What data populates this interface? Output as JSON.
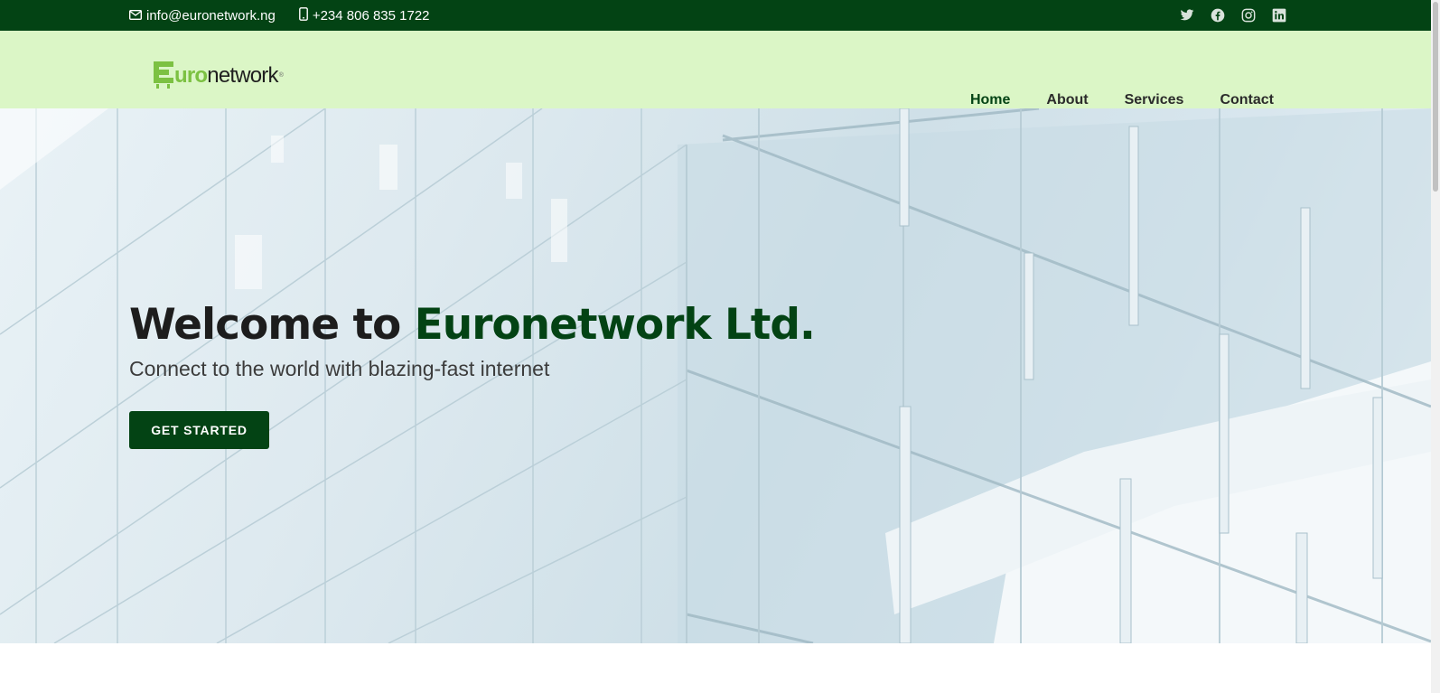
{
  "topbar": {
    "email": "info@euronetwork.ng",
    "phone": "+234 806 835 1722",
    "social": [
      "twitter-icon",
      "facebook-icon",
      "instagram-icon",
      "linkedin-icon"
    ]
  },
  "header": {
    "logo": {
      "part_uro": "uro",
      "part_network": "network",
      "mark": "®"
    },
    "nav": [
      {
        "label": "Home",
        "active": true
      },
      {
        "label": "About",
        "active": false
      },
      {
        "label": "Services",
        "active": false
      },
      {
        "label": "Contact",
        "active": false
      }
    ]
  },
  "hero": {
    "title_prefix": "Welcome to ",
    "title_brand": "Euronetwork Ltd.",
    "subtitle": "Connect to the world with blazing-fast internet",
    "cta_label": "GET STARTED"
  },
  "colors": {
    "topbar_bg": "#034314",
    "header_bg": "#dbf6c6",
    "brand_dark_green": "#034314",
    "logo_green": "#7cc142"
  }
}
